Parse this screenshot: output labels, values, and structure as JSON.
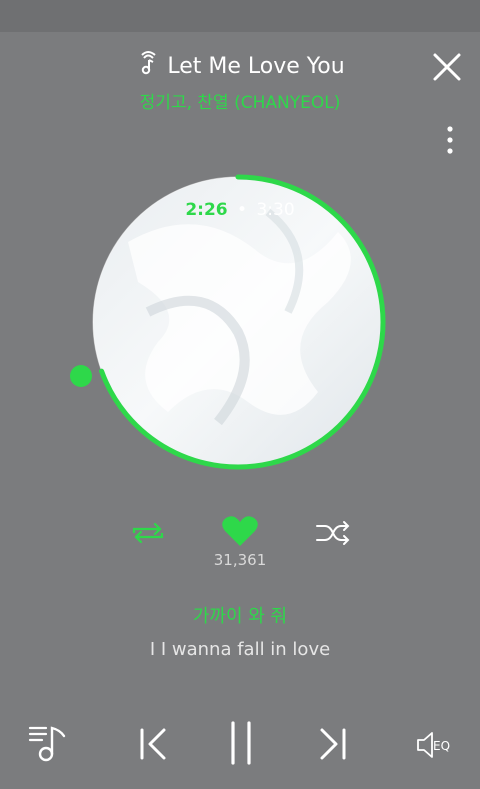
{
  "song": {
    "title": "Let Me Love You",
    "artist": "정기고, 찬열 (CHANYEOL)"
  },
  "playback": {
    "current_time": "2:26",
    "separator": "•",
    "total_time": "3:30",
    "progress_fraction": 0.695
  },
  "likes": {
    "count": "31,361"
  },
  "lyrics": {
    "current": "가까이 와 줘",
    "next": "I I wanna fall in love"
  },
  "colors": {
    "accent": "#2ed84a",
    "background": "#7b7c7e"
  },
  "icons": {
    "title_icon": "music-note-icon",
    "close": "close-icon",
    "more": "more-vertical-icon",
    "repeat": "repeat-icon",
    "like": "heart-icon",
    "shuffle": "shuffle-icon",
    "playlist": "playlist-icon",
    "prev": "previous-icon",
    "pause": "pause-icon",
    "next": "next-icon",
    "eq": "equalizer-icon"
  },
  "eq_label": "EQ"
}
